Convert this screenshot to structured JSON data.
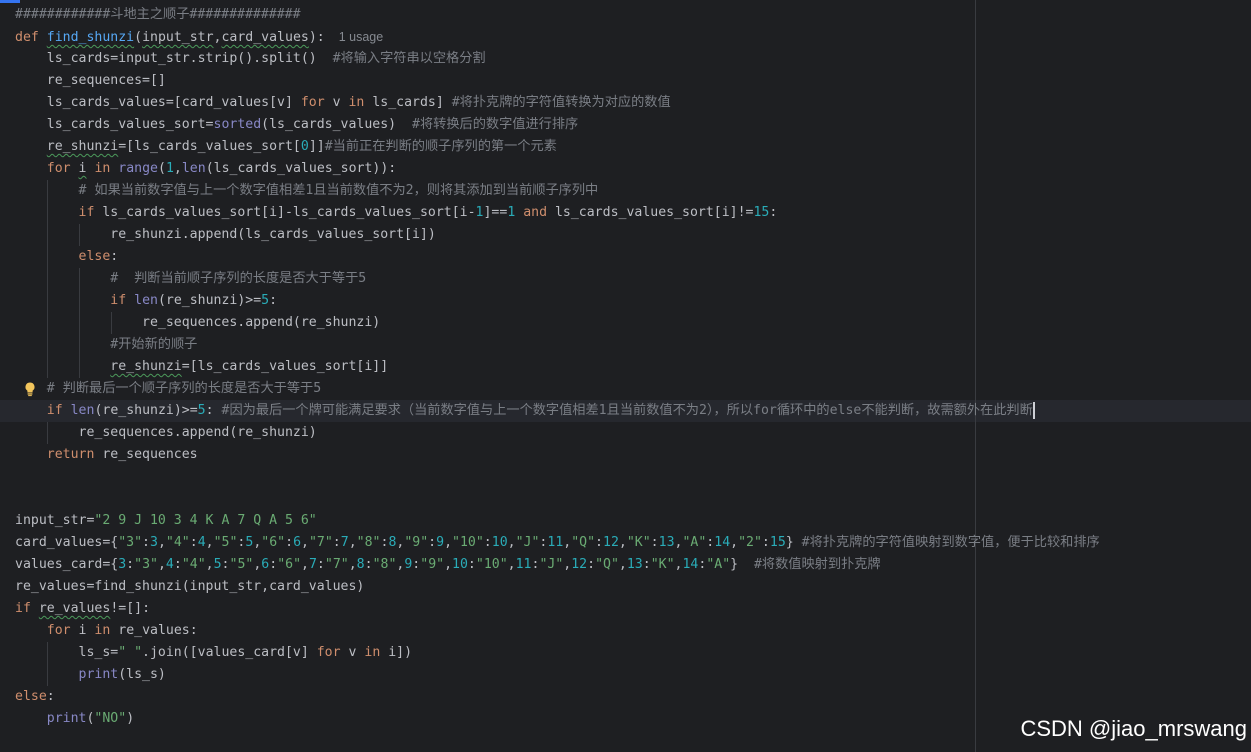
{
  "editor": {
    "code_lines": [
      [
        {
          "t": "############斗地主之顺子##############",
          "c": "cm"
        }
      ],
      [
        {
          "t": "def ",
          "c": "kw"
        },
        {
          "t": "find_shunzi",
          "c": "fn wavy"
        },
        {
          "t": "("
        },
        {
          "t": "input_str",
          "c": "wavy"
        },
        {
          "t": ","
        },
        {
          "t": "card_values",
          "c": "wavy"
        },
        {
          "t": "):"
        },
        {
          "t": "1 usage",
          "c": "usage"
        }
      ],
      [
        {
          "t": "    ls_cards=input_str.strip().split()  "
        },
        {
          "t": "#将输入字符串以空格分割",
          "c": "cm"
        }
      ],
      [
        {
          "t": "    re_sequences=[]"
        }
      ],
      [
        {
          "t": "    ls_cards_values=[card_values[v] "
        },
        {
          "t": "for",
          "c": "kw"
        },
        {
          "t": " v "
        },
        {
          "t": "in",
          "c": "kw"
        },
        {
          "t": " ls_cards] "
        },
        {
          "t": "#将扑克牌的字符值转换为对应的数值",
          "c": "cm"
        }
      ],
      [
        {
          "t": "    ls_cards_values_sort="
        },
        {
          "t": "sorted",
          "c": "bi"
        },
        {
          "t": "(ls_cards_values)  "
        },
        {
          "t": "#将转换后的数字值进行排序",
          "c": "cm"
        }
      ],
      [
        {
          "t": "    "
        },
        {
          "t": "re_shunzi",
          "c": "wavy"
        },
        {
          "t": "=[ls_cards_values_sort["
        },
        {
          "t": "0",
          "c": "num"
        },
        {
          "t": "]]"
        },
        {
          "t": "#当前正在判断的顺子序列的第一个元素",
          "c": "cm"
        }
      ],
      [
        {
          "t": "    "
        },
        {
          "t": "for",
          "c": "kw"
        },
        {
          "t": " "
        },
        {
          "t": "i",
          "c": "wavy"
        },
        {
          "t": " "
        },
        {
          "t": "in",
          "c": "kw"
        },
        {
          "t": " "
        },
        {
          "t": "range",
          "c": "bi"
        },
        {
          "t": "("
        },
        {
          "t": "1",
          "c": "num"
        },
        {
          "t": ","
        },
        {
          "t": "len",
          "c": "bi"
        },
        {
          "t": "(ls_cards_values_sort)):"
        }
      ],
      [
        {
          "t": "        "
        },
        {
          "t": "# 如果当前数字值与上一个数字值相差1且当前数值不为2，则将其添加到当前顺子序列中",
          "c": "cm"
        }
      ],
      [
        {
          "t": "        "
        },
        {
          "t": "if",
          "c": "kw"
        },
        {
          "t": " ls_cards_values_sort[i]-ls_cards_values_sort[i-"
        },
        {
          "t": "1",
          "c": "num"
        },
        {
          "t": "]=="
        },
        {
          "t": "1",
          "c": "num"
        },
        {
          "t": " "
        },
        {
          "t": "and",
          "c": "kw"
        },
        {
          "t": " ls_cards_values_sort[i]!="
        },
        {
          "t": "15",
          "c": "num"
        },
        {
          "t": ":"
        }
      ],
      [
        {
          "t": "            re_shunzi.append(ls_cards_values_sort[i])"
        }
      ],
      [
        {
          "t": "        "
        },
        {
          "t": "else",
          "c": "kw"
        },
        {
          "t": ":"
        }
      ],
      [
        {
          "t": "            "
        },
        {
          "t": "#  判断当前顺子序列的长度是否大于等于5",
          "c": "cm"
        }
      ],
      [
        {
          "t": "            "
        },
        {
          "t": "if",
          "c": "kw"
        },
        {
          "t": " "
        },
        {
          "t": "len",
          "c": "bi"
        },
        {
          "t": "(re_shunzi)>="
        },
        {
          "t": "5",
          "c": "num"
        },
        {
          "t": ":"
        }
      ],
      [
        {
          "t": "                re_sequences.append(re_shunzi)"
        }
      ],
      [
        {
          "t": "            "
        },
        {
          "t": "#开始新的顺子",
          "c": "cm"
        }
      ],
      [
        {
          "t": "            "
        },
        {
          "t": "re_shunzi",
          "c": "wavy"
        },
        {
          "t": "=[ls_cards_values_sort[i]]"
        }
      ],
      [
        {
          "t": "    "
        },
        {
          "t": "# 判断最后一个顺子序列的长度是否大于等于5",
          "c": "cm"
        }
      ],
      [
        {
          "t": "    "
        },
        {
          "t": "if",
          "c": "kw"
        },
        {
          "t": " "
        },
        {
          "t": "len",
          "c": "bi"
        },
        {
          "t": "(re_shunzi)>="
        },
        {
          "t": "5",
          "c": "num"
        },
        {
          "t": ": "
        },
        {
          "t": "#因为最后一个牌可能满足要求（当前数字值与上一个数字值相差1且当前数值不为2），所以for循环中的else不能判断，故需额外在此判断",
          "c": "cm"
        }
      ],
      [
        {
          "t": "        re_sequences.append(re_shunzi)"
        }
      ],
      [
        {
          "t": "    "
        },
        {
          "t": "return",
          "c": "kw"
        },
        {
          "t": " re_sequences"
        }
      ],
      [],
      [],
      [
        {
          "t": "input_str="
        },
        {
          "t": "\"2 9 J 10 3 4 K A 7 Q A 5 6\"",
          "c": "str"
        }
      ],
      [
        {
          "t": "card_values={"
        },
        {
          "t": "\"3\"",
          "c": "str"
        },
        {
          "t": ":"
        },
        {
          "t": "3",
          "c": "num"
        },
        {
          "t": ","
        },
        {
          "t": "\"4\"",
          "c": "str"
        },
        {
          "t": ":"
        },
        {
          "t": "4",
          "c": "num"
        },
        {
          "t": ","
        },
        {
          "t": "\"5\"",
          "c": "str"
        },
        {
          "t": ":"
        },
        {
          "t": "5",
          "c": "num"
        },
        {
          "t": ","
        },
        {
          "t": "\"6\"",
          "c": "str"
        },
        {
          "t": ":"
        },
        {
          "t": "6",
          "c": "num"
        },
        {
          "t": ","
        },
        {
          "t": "\"7\"",
          "c": "str"
        },
        {
          "t": ":"
        },
        {
          "t": "7",
          "c": "num"
        },
        {
          "t": ","
        },
        {
          "t": "\"8\"",
          "c": "str"
        },
        {
          "t": ":"
        },
        {
          "t": "8",
          "c": "num"
        },
        {
          "t": ","
        },
        {
          "t": "\"9\"",
          "c": "str"
        },
        {
          "t": ":"
        },
        {
          "t": "9",
          "c": "num"
        },
        {
          "t": ","
        },
        {
          "t": "\"10\"",
          "c": "str"
        },
        {
          "t": ":"
        },
        {
          "t": "10",
          "c": "num"
        },
        {
          "t": ","
        },
        {
          "t": "\"J\"",
          "c": "str"
        },
        {
          "t": ":"
        },
        {
          "t": "11",
          "c": "num"
        },
        {
          "t": ","
        },
        {
          "t": "\"Q\"",
          "c": "str"
        },
        {
          "t": ":"
        },
        {
          "t": "12",
          "c": "num"
        },
        {
          "t": ","
        },
        {
          "t": "\"K\"",
          "c": "str"
        },
        {
          "t": ":"
        },
        {
          "t": "13",
          "c": "num"
        },
        {
          "t": ","
        },
        {
          "t": "\"A\"",
          "c": "str"
        },
        {
          "t": ":"
        },
        {
          "t": "14",
          "c": "num"
        },
        {
          "t": ","
        },
        {
          "t": "\"2\"",
          "c": "str"
        },
        {
          "t": ":"
        },
        {
          "t": "15",
          "c": "num"
        },
        {
          "t": "} "
        },
        {
          "t": "#将扑克牌的字符值映射到数字值，便于比较和排序",
          "c": "cm"
        }
      ],
      [
        {
          "t": "values_card={"
        },
        {
          "t": "3",
          "c": "num"
        },
        {
          "t": ":"
        },
        {
          "t": "\"3\"",
          "c": "str"
        },
        {
          "t": ","
        },
        {
          "t": "4",
          "c": "num"
        },
        {
          "t": ":"
        },
        {
          "t": "\"4\"",
          "c": "str"
        },
        {
          "t": ","
        },
        {
          "t": "5",
          "c": "num"
        },
        {
          "t": ":"
        },
        {
          "t": "\"5\"",
          "c": "str"
        },
        {
          "t": ","
        },
        {
          "t": "6",
          "c": "num"
        },
        {
          "t": ":"
        },
        {
          "t": "\"6\"",
          "c": "str"
        },
        {
          "t": ","
        },
        {
          "t": "7",
          "c": "num"
        },
        {
          "t": ":"
        },
        {
          "t": "\"7\"",
          "c": "str"
        },
        {
          "t": ","
        },
        {
          "t": "8",
          "c": "num"
        },
        {
          "t": ":"
        },
        {
          "t": "\"8\"",
          "c": "str"
        },
        {
          "t": ","
        },
        {
          "t": "9",
          "c": "num"
        },
        {
          "t": ":"
        },
        {
          "t": "\"9\"",
          "c": "str"
        },
        {
          "t": ","
        },
        {
          "t": "10",
          "c": "num"
        },
        {
          "t": ":"
        },
        {
          "t": "\"10\"",
          "c": "str"
        },
        {
          "t": ","
        },
        {
          "t": "11",
          "c": "num"
        },
        {
          "t": ":"
        },
        {
          "t": "\"J\"",
          "c": "str"
        },
        {
          "t": ","
        },
        {
          "t": "12",
          "c": "num"
        },
        {
          "t": ":"
        },
        {
          "t": "\"Q\"",
          "c": "str"
        },
        {
          "t": ","
        },
        {
          "t": "13",
          "c": "num"
        },
        {
          "t": ":"
        },
        {
          "t": "\"K\"",
          "c": "str"
        },
        {
          "t": ","
        },
        {
          "t": "14",
          "c": "num"
        },
        {
          "t": ":"
        },
        {
          "t": "\"A\"",
          "c": "str"
        },
        {
          "t": "}  "
        },
        {
          "t": "#将数值映射到扑克牌",
          "c": "cm"
        }
      ],
      [
        {
          "t": "re_values=find_shunzi(input_str,card_values)"
        }
      ],
      [
        {
          "t": "if",
          "c": "kw"
        },
        {
          "t": " "
        },
        {
          "t": "re_values",
          "c": "wavy"
        },
        {
          "t": "!=[]:"
        }
      ],
      [
        {
          "t": "    "
        },
        {
          "t": "for",
          "c": "kw"
        },
        {
          "t": " i "
        },
        {
          "t": "in",
          "c": "kw"
        },
        {
          "t": " re_values:"
        }
      ],
      [
        {
          "t": "        ls_s="
        },
        {
          "t": "\" \"",
          "c": "str"
        },
        {
          "t": ".join([values_card[v] "
        },
        {
          "t": "for",
          "c": "kw"
        },
        {
          "t": " v "
        },
        {
          "t": "in",
          "c": "kw"
        },
        {
          "t": " i])"
        }
      ],
      [
        {
          "t": "        "
        },
        {
          "t": "print",
          "c": "bi"
        },
        {
          "t": "(ls_s)"
        }
      ],
      [
        {
          "t": "else",
          "c": "kw"
        },
        {
          "t": ":"
        }
      ],
      [
        {
          "t": "    "
        },
        {
          "t": "print",
          "c": "bi"
        },
        {
          "t": "("
        },
        {
          "t": "\"NO\"",
          "c": "str"
        },
        {
          "t": ")"
        }
      ]
    ],
    "caret_line": 18,
    "bulb_line": 17
  },
  "colors": {
    "background": "#1e1f22",
    "keyword": "#cf8e6d",
    "function": "#56a8f5",
    "builtin": "#8888c6",
    "number": "#2aacb8",
    "string": "#6aab73",
    "comment": "#7a7e85",
    "text": "#bcbec4"
  },
  "icons": {
    "intention": "lightbulb-icon"
  },
  "watermark": {
    "text": "CSDN @jiao_mrswang"
  }
}
